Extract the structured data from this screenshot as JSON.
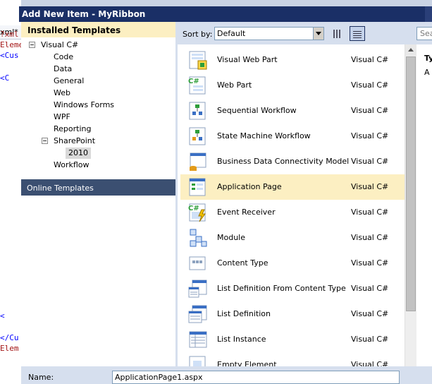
{
  "editor": {
    "tab_label": "xml*",
    "code_lines": [
      {
        "text": "?xml",
        "color": "#a31515"
      },
      {
        "text": "Eleme",
        "color": "#a31515"
      },
      {
        "text": "<Cus",
        "color": "#0000ff"
      },
      {
        "text": "<C",
        "color": "#0000ff"
      },
      {
        "text": "<",
        "color": "#0000ff"
      },
      {
        "text": "</Cu",
        "color": "#0000ff"
      },
      {
        "text": "Elem",
        "color": "#a31515"
      }
    ]
  },
  "dialog": {
    "title": "Add New Item - MyRibbon",
    "installed_header": "Installed Templates",
    "tree": [
      {
        "label": "Visual C#",
        "expander": true
      },
      {
        "label": "Code"
      },
      {
        "label": "Data"
      },
      {
        "label": "General"
      },
      {
        "label": "Web"
      },
      {
        "label": "Windows Forms"
      },
      {
        "label": "WPF"
      },
      {
        "label": "Reporting"
      },
      {
        "label": "SharePoint",
        "expander": true
      },
      {
        "label": "2010",
        "selected": true
      },
      {
        "label": "Workflow"
      }
    ],
    "online_templates": "Online Templates",
    "sort_label": "Sort by:",
    "sort_value": "Default",
    "search_placeholder": "Sear",
    "templates": [
      {
        "name": "Visual Web Part",
        "lang": "Visual C#",
        "icon": "visual-web-part-icon"
      },
      {
        "name": "Web Part",
        "lang": "Visual C#",
        "icon": "web-part-icon"
      },
      {
        "name": "Sequential Workflow",
        "lang": "Visual C#",
        "icon": "sequential-workflow-icon"
      },
      {
        "name": "State Machine Workflow",
        "lang": "Visual C#",
        "icon": "state-machine-workflow-icon"
      },
      {
        "name": "Business Data Connectivity Model",
        "lang": "Visual C#",
        "icon": "bdc-model-icon"
      },
      {
        "name": "Application Page",
        "lang": "Visual C#",
        "icon": "application-page-icon",
        "selected": true
      },
      {
        "name": "Event Receiver",
        "lang": "Visual C#",
        "icon": "event-receiver-icon"
      },
      {
        "name": "Module",
        "lang": "Visual C#",
        "icon": "module-icon"
      },
      {
        "name": "Content Type",
        "lang": "Visual C#",
        "icon": "content-type-icon"
      },
      {
        "name": "List Definition From Content Type",
        "lang": "Visual C#",
        "icon": "list-definition-from-content-type-icon"
      },
      {
        "name": "List Definition",
        "lang": "Visual C#",
        "icon": "list-definition-icon"
      },
      {
        "name": "List Instance",
        "lang": "Visual C#",
        "icon": "list-instance-icon"
      },
      {
        "name": "Empty Element",
        "lang": "Visual C#",
        "icon": "empty-element-icon"
      }
    ],
    "info_type_label": "Ty",
    "info_description": "A",
    "name_label": "Name:",
    "name_value": "ApplicationPage1.aspx"
  },
  "colors": {
    "title_bar": "#1a2f66",
    "selection": "#fcefc2",
    "online_templates_bg": "#3b4f71",
    "dialog_bg": "#d6dfee"
  }
}
